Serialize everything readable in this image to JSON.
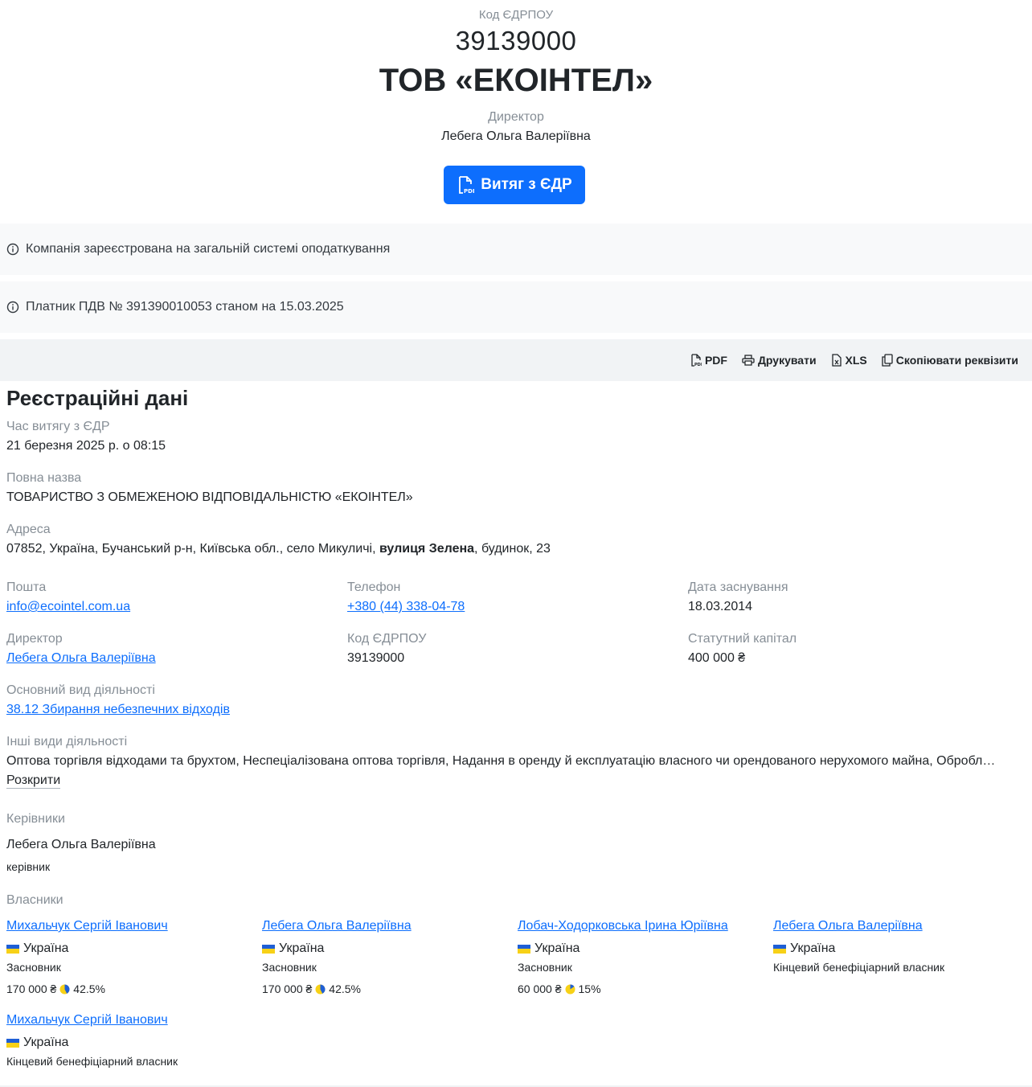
{
  "header": {
    "code_label": "Код ЄДРПОУ",
    "code": "39139000",
    "name": "ТОВ «ЕКОІНТЕЛ»",
    "director_label": "Директор",
    "director_name": "Лебега Ольга Валеріївна",
    "extract_button": "Витяг з ЄДР"
  },
  "notices": {
    "tax_system": "Компанія зареєстрована на загальній системі оподаткування",
    "vat": "Платник ПДВ № 391390010053 станом на 15.03.2025"
  },
  "toolbar": {
    "pdf": "PDF",
    "print": "Друкувати",
    "xls": "XLS",
    "copy": "Скопіювати реквізити"
  },
  "registration": {
    "title": "Реєстраційні дані",
    "extract_time_label": "Час витягу з ЄДР",
    "extract_time": "21 березня 2025 р. о 08:15",
    "full_name_label": "Повна назва",
    "full_name": "ТОВАРИСТВО З ОБМЕЖЕНОЮ ВІДПОВІДАЛЬНІСТЮ «ЕКОІНТЕЛ»",
    "address_label": "Адреса",
    "address_pre": "07852, Україна, Бучанський р-н, Київська обл., село Микуличі, ",
    "address_street": "вулиця Зелена",
    "address_post": ", будинок, 23",
    "email_label": "Пошта",
    "email": "info@ecointel.com.ua",
    "phone_label": "Телефон",
    "phone": "+380 (44) 338-04-78",
    "founded_label": "Дата заснування",
    "founded": "18.03.2014",
    "director_label": "Директор",
    "director": "Лебега Ольга Валеріївна",
    "code_label": "Код ЄДРПОУ",
    "code": "39139000",
    "capital_label": "Статутний капітал",
    "capital": "400 000 ₴",
    "main_activity_label": "Основний вид діяльності",
    "main_activity": "38.12 Збирання небезпечних відходів",
    "other_activities_label": "Інші види діяльності",
    "other_activities": "Оптова торгівля відходами та брухтом, Неспеціалізована оптова торгівля, Надання в оренду й експлуатацію власного чи орендованого нерухомого майна, Обробл…",
    "expand": "Розкрити",
    "managers_label": "Керівники",
    "manager_name": "Лебега Ольга Валеріївна",
    "manager_role": "керівник",
    "owners_label": "Власники"
  },
  "owners": [
    {
      "name": "Михальчук Сергій Іванович",
      "country": "Україна",
      "role": "Засновник",
      "amount": "170 000 ₴",
      "percent": "42.5%",
      "share": 0.425
    },
    {
      "name": "Лебега Ольга Валеріївна",
      "country": "Україна",
      "role": "Засновник",
      "amount": "170 000 ₴",
      "percent": "42.5%",
      "share": 0.425
    },
    {
      "name": "Лобач-Ходорковська Ірина Юріївна",
      "country": "Україна",
      "role": "Засновник",
      "amount": "60 000 ₴",
      "percent": "15%",
      "share": 0.15
    },
    {
      "name": "Лебега Ольга Валеріївна",
      "country": "Україна",
      "role": "Кінцевий бенефіціарний власник"
    },
    {
      "name": "Михальчук Сергій Іванович",
      "country": "Україна",
      "role": "Кінцевий бенефіціарний власник"
    }
  ],
  "colors": {
    "accent": "#0d6efd",
    "flag_blue": "#1f5fd6",
    "flag_yellow": "#f7d117"
  }
}
